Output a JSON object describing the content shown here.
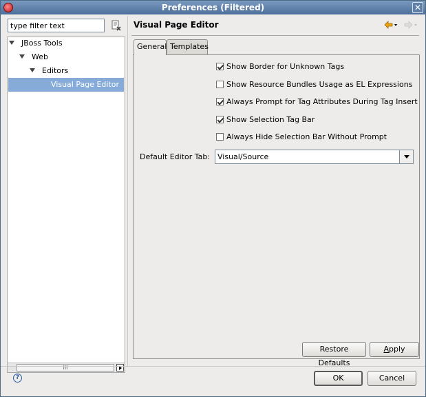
{
  "window": {
    "title": "Preferences (Filtered)",
    "close_glyph": "✕",
    "icon": "eclipse-app-icon"
  },
  "filter": {
    "placeholder": "type filter text",
    "value": "type filter text"
  },
  "tree": {
    "items": [
      {
        "label": "JBoss Tools",
        "expanded": true,
        "selected": false
      },
      {
        "label": "Web",
        "expanded": true,
        "selected": false
      },
      {
        "label": "Editors",
        "expanded": true,
        "selected": false
      },
      {
        "label": "Visual Page Editor",
        "expanded": false,
        "selected": true
      }
    ],
    "hscroll_grip": "III"
  },
  "page": {
    "title": "Visual Page Editor"
  },
  "tabs": [
    {
      "label": "General",
      "active": true
    },
    {
      "label": "Templates",
      "active": false
    }
  ],
  "options": [
    {
      "label": "Show Border for Unknown Tags",
      "checked": true
    },
    {
      "label": "Show Resource Bundles Usage as EL Expressions",
      "checked": false
    },
    {
      "label": "Always Prompt for Tag Attributes During Tag Insert",
      "checked": true
    },
    {
      "label": "Show Selection Tag Bar",
      "checked": true
    },
    {
      "label": "Always Hide Selection Bar Without Prompt",
      "checked": false
    }
  ],
  "default_tab": {
    "label": "Default Editor Tab:",
    "value": "Visual/Source"
  },
  "buttons": {
    "restore_pre": "Restore ",
    "restore_mn": "D",
    "restore_post": "efaults",
    "apply_mn": "A",
    "apply_post": "pply",
    "ok": "OK",
    "cancel": "Cancel"
  },
  "help": {
    "glyph": "?"
  },
  "colors": {
    "selection": "#86abd9",
    "titlebar": "#4d6f9a",
    "nav_back": "#e8a317"
  }
}
